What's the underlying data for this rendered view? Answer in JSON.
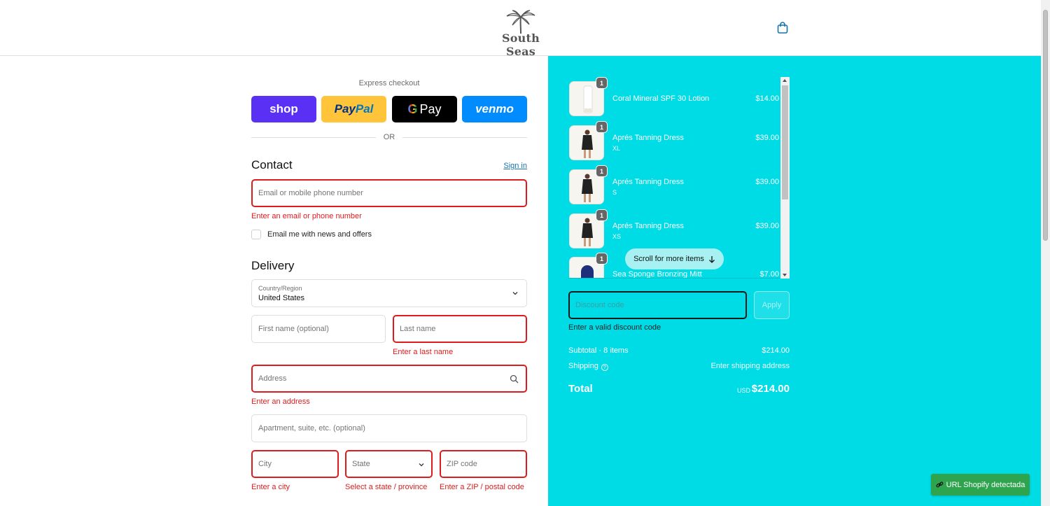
{
  "header": {
    "brand": "South Seas"
  },
  "express": {
    "label": "Express checkout",
    "buttons": {
      "shop": "shop",
      "paypal_a": "Pay",
      "paypal_b": "Pal",
      "gpay_g": "G",
      "gpay": "Pay",
      "venmo": "venmo"
    },
    "or": "OR"
  },
  "contact": {
    "title": "Contact",
    "sign_in": "Sign in",
    "email_placeholder": "Email or mobile phone number",
    "email_error": "Enter an email or phone number",
    "news_label": "Email me with news and offers"
  },
  "delivery": {
    "title": "Delivery",
    "country_label": "Country/Region",
    "country_value": "United States",
    "first_name_placeholder": "First name (optional)",
    "last_name_placeholder": "Last name",
    "last_name_error": "Enter a last name",
    "address_placeholder": "Address",
    "address_error": "Enter an address",
    "apartment_placeholder": "Apartment, suite, etc. (optional)",
    "city_placeholder": "City",
    "city_error": "Enter a city",
    "state_placeholder": "State",
    "state_error": "Select a state / province",
    "zip_placeholder": "ZIP code",
    "zip_error": "Enter a ZIP / postal code"
  },
  "cart": {
    "items": [
      {
        "qty": "1",
        "name": "Coral Mineral SPF 30 Lotion",
        "variant": "",
        "price": "$14.00"
      },
      {
        "qty": "1",
        "name": "Aprés Tanning Dress",
        "variant": "XL",
        "price": "$39.00"
      },
      {
        "qty": "1",
        "name": "Aprés Tanning Dress",
        "variant": "S",
        "price": "$39.00"
      },
      {
        "qty": "1",
        "name": "Aprés Tanning Dress",
        "variant": "XS",
        "price": "$39.00"
      },
      {
        "qty": "1",
        "name": "Sea Sponge Bronzing Mitt",
        "variant": "",
        "price": "$7.00"
      }
    ],
    "scroll_hint": "Scroll for more items"
  },
  "discount": {
    "placeholder": "Discount code",
    "apply": "Apply",
    "error": "Enter a valid discount code"
  },
  "summary": {
    "subtotal_label": "Subtotal · 8 items",
    "subtotal_value": "$214.00",
    "shipping_label": "Shipping",
    "shipping_value": "Enter shipping address",
    "total_label": "Total",
    "currency": "USD",
    "total_value": "$214.00"
  },
  "extension_badge": "URL Shopify detectada",
  "colors": {
    "summary_bg": "#00dce6",
    "error": "#dd1d1d",
    "link": "#1773b0",
    "shop_pay": "#5a31f4",
    "paypal": "#ffc439",
    "venmo": "#008cff",
    "badge": "#2ea44f"
  }
}
